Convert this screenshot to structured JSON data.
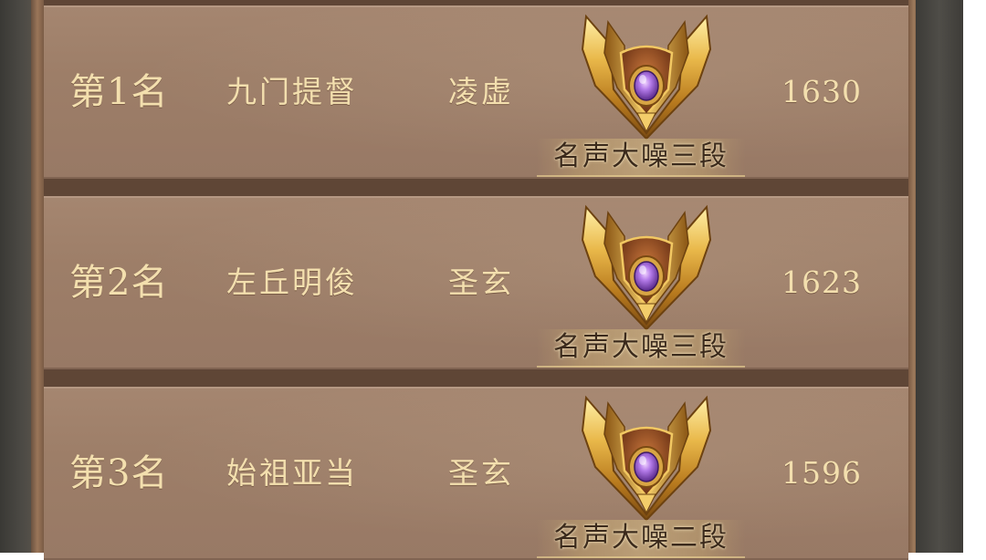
{
  "leaderboard": {
    "rows": [
      {
        "rank": "第1名",
        "name": "九门提督",
        "faction": "凌虚",
        "badge_icon": "gold-crest-purple-gem-icon",
        "tier": "名声大噪三段",
        "score": "1630"
      },
      {
        "rank": "第2名",
        "name": "左丘明俊",
        "faction": "圣玄",
        "badge_icon": "gold-crest-purple-gem-icon",
        "tier": "名声大噪三段",
        "score": "1623"
      },
      {
        "rank": "第3名",
        "name": "始祖亚当",
        "faction": "圣玄",
        "badge_icon": "gold-crest-purple-gem-icon",
        "tier": "名声大噪二段",
        "score": "1596"
      }
    ]
  },
  "colors": {
    "row_text": "#f3dfae",
    "panel_bg": "#9d7e68",
    "badge_gold": "#d9a63a",
    "badge_gem": "#9b5bd6"
  }
}
